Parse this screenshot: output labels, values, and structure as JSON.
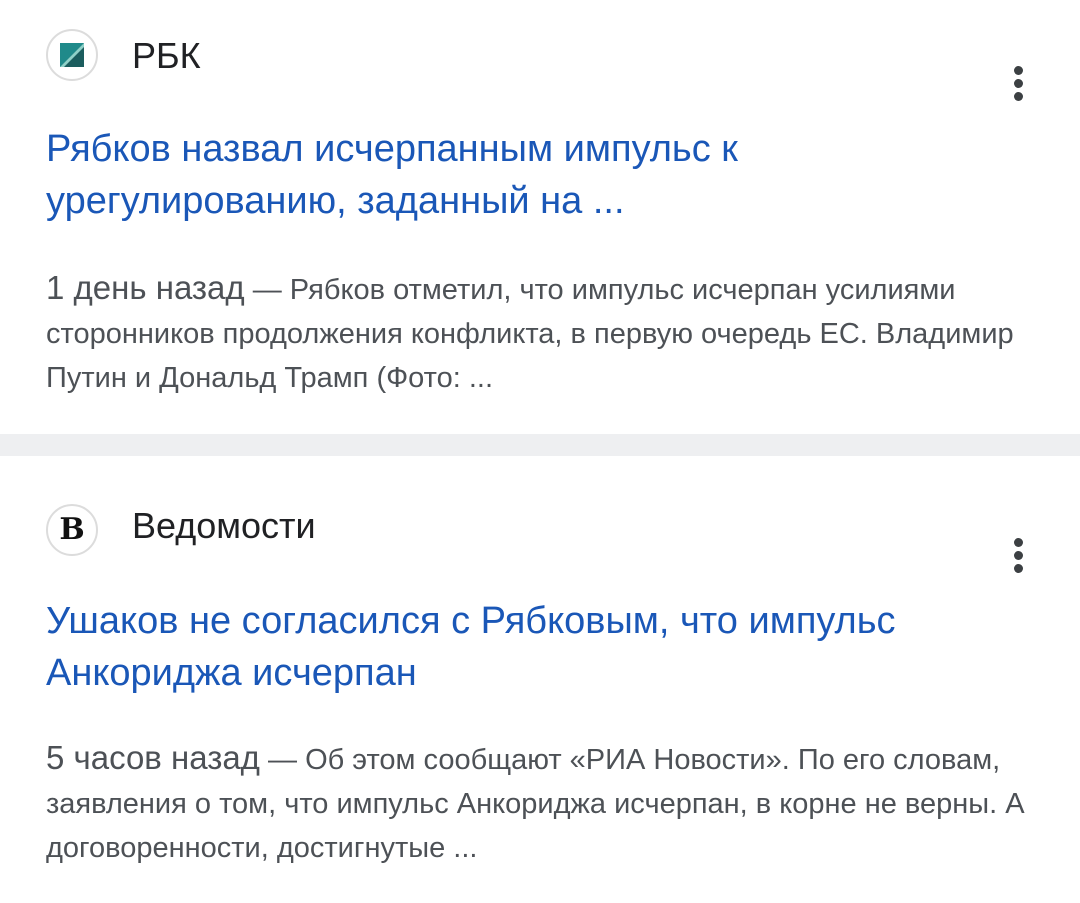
{
  "results": [
    {
      "source": "РБК",
      "favicon": "rbk-logo",
      "headline": "Рябков назвал исчерпанным импульс к урегулированию, заданный на ...",
      "age": "1 день назад",
      "separator": " — ",
      "snippet": "Рябков отметил, что импульс исчерпан усилиями сторонников продолжения конфликта, в первую очередь ЕС. Владимир Путин и Дональд Трамп (Фото: ..."
    },
    {
      "source": "Ведомости",
      "favicon": "vedomosti-logo",
      "favicon_letter": "B",
      "headline": "Ушаков не согласился с Рябковым, что импульс Анкориджа исчерпан",
      "age": "5 часов назад",
      "separator": " — ",
      "snippet": "Об этом сообщают «РИА Новости». По его словам, заявления о том, что импульс Анкориджа исчерпан, в корне не верны. А договоренности, достигнутые ..."
    }
  ],
  "colors": {
    "headline": "#1a57b7",
    "snippet": "#4d5156",
    "source": "#202124",
    "divider": "#eeeff1",
    "rbk_teal": "#1f8a8a",
    "rbk_dark": "#1b5d5e"
  }
}
